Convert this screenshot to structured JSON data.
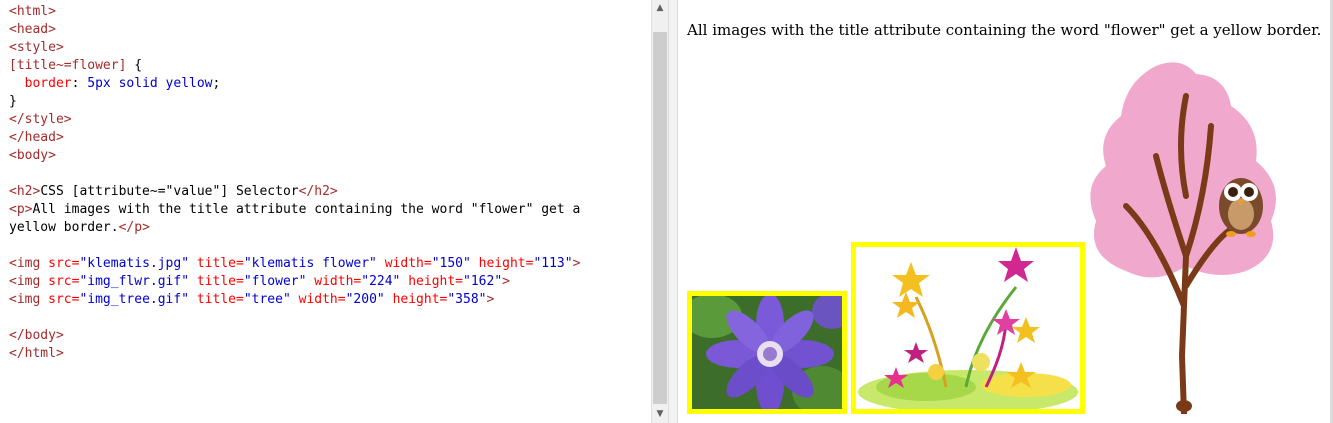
{
  "editor": {
    "lines": [
      "<html>",
      "<head>",
      "<style>",
      "[title~=flower] {",
      "  border: 5px solid yellow;",
      "}",
      "</style>",
      "</head>",
      "<body>",
      "",
      "<h2>CSS [attribute~=\"value\"] Selector</h2>",
      "<p>All images with the title attribute containing the word \"flower\" get a",
      "yellow border.</p>",
      "",
      "<img src=\"klematis.jpg\" title=\"klematis flower\" width=\"150\" height=\"113\">",
      "<img src=\"img_flwr.gif\" title=\"flower\" width=\"224\" height=\"162\">",
      "<img src=\"img_tree.gif\" title=\"tree\" width=\"200\" height=\"358\">",
      "",
      "</body>",
      "</html>"
    ]
  },
  "preview": {
    "paragraph": "All images with the title attribute containing the word \"flower\" get a yellow border.",
    "images": [
      {
        "name": "klematis flower",
        "border_color": "#ffff00"
      },
      {
        "name": "flower",
        "border_color": "#ffff00"
      },
      {
        "name": "tree"
      }
    ]
  },
  "colors": {
    "tag": "#a52a2a",
    "attribute": "#ff0000",
    "value": "#0000cd",
    "highlight_border": "#ffff00"
  },
  "icons": {
    "scroll_up": "chevron-up-icon",
    "scroll_down": "chevron-down-icon"
  }
}
